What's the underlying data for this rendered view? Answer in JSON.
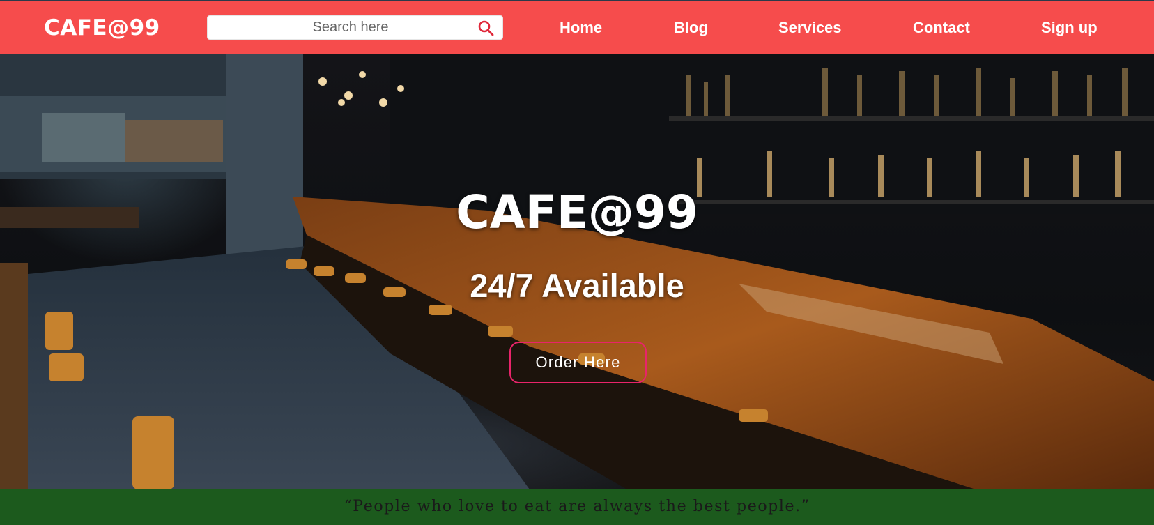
{
  "brand": {
    "name": "CAFE@99"
  },
  "search": {
    "placeholder": "Search here",
    "icon": "search-icon"
  },
  "nav": {
    "items": [
      {
        "label": "Home"
      },
      {
        "label": "Blog"
      },
      {
        "label": "Services"
      },
      {
        "label": "Contact"
      },
      {
        "label": "Sign up"
      }
    ]
  },
  "hero": {
    "title": "CAFE@99",
    "subtitle": "24/7 Available",
    "cta_label": "Order Here"
  },
  "quote": {
    "text": "“People who love to eat are always the best people.”"
  },
  "colors": {
    "navbar": "#f64c4c",
    "button_border": "#e8246a",
    "quote_bar": "#1c5a1d"
  }
}
